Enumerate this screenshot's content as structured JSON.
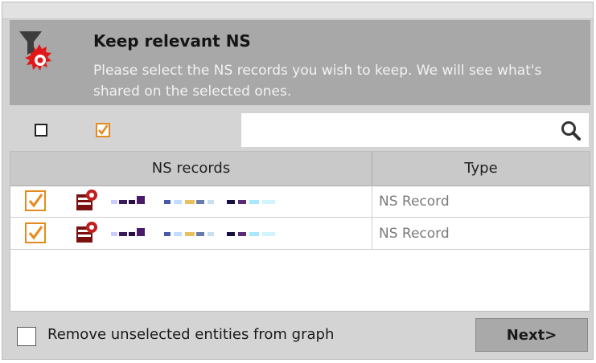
{
  "header": {
    "title": "Keep relevant NS",
    "description": "Please select the NS records you wish to keep. We will see what's shared on the selected ones.",
    "icon": "filter-target-icon"
  },
  "toolbar": {
    "deselect_all_icon": "checkbox-empty-icon",
    "select_all_icon": "checkbox-checked-icon",
    "search": {
      "value": "",
      "placeholder": ""
    }
  },
  "table": {
    "columns": [
      "NS records",
      "Type"
    ],
    "rows": [
      {
        "checked": true,
        "entity_icon": "ns-record-icon",
        "name": "[redacted]",
        "type": "NS Record"
      },
      {
        "checked": true,
        "entity_icon": "ns-record-icon",
        "name": "[redacted]",
        "type": "NS Record"
      }
    ]
  },
  "footer": {
    "remove_label": "Remove unselected entities from graph",
    "remove_checked": false,
    "next_label": "Next>"
  },
  "colors": {
    "header_bg": "#a8a8a8",
    "checkbox_accent": "#e58a1f",
    "button_bg": "#a9a9a9"
  }
}
